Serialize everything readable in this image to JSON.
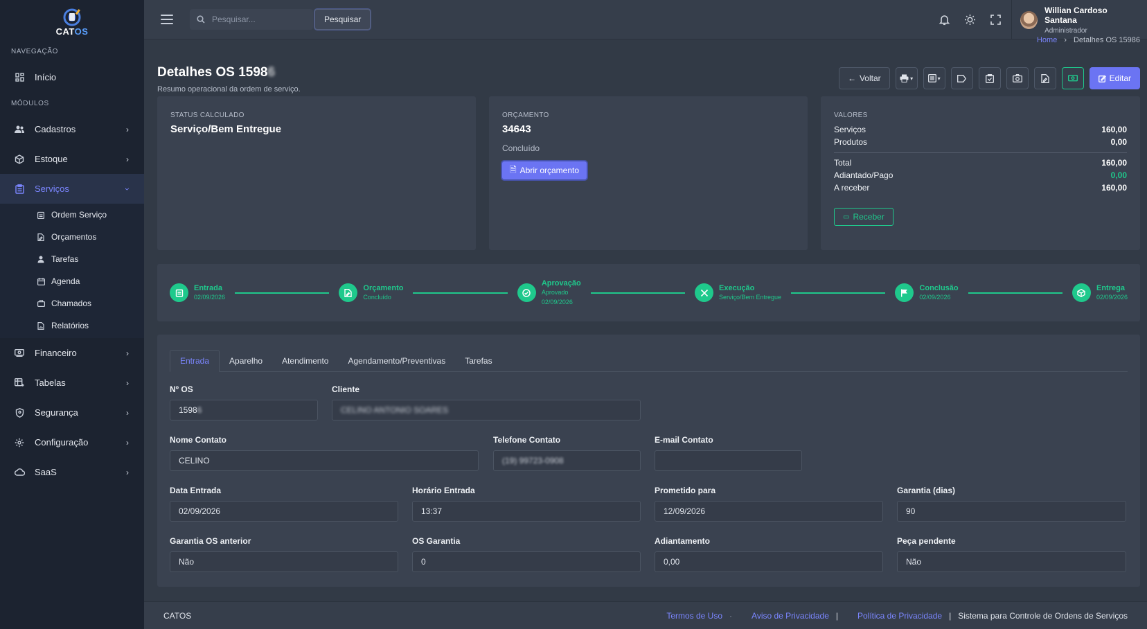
{
  "brand": {
    "logo_text_main": "CAT",
    "logo_text_accent": "OS"
  },
  "sidebar": {
    "section_nav": "NAVEGAÇÃO",
    "section_modules": "MÓDULOS",
    "inicio": "Início",
    "items": [
      {
        "label": "Cadastros",
        "icon": "users-icon"
      },
      {
        "label": "Estoque",
        "icon": "box-icon"
      },
      {
        "label": "Serviços",
        "icon": "clipboard-icon"
      },
      {
        "label": "Financeiro",
        "icon": "money-icon"
      },
      {
        "label": "Tabelas",
        "icon": "table-icon"
      },
      {
        "label": "Segurança",
        "icon": "shield-icon"
      },
      {
        "label": "Configuração",
        "icon": "gear-icon"
      },
      {
        "label": "SaaS",
        "icon": "cloud-icon"
      }
    ],
    "sub_items": [
      "Ordem Serviço",
      "Orçamentos",
      "Tarefas",
      "Agenda",
      "Chamados",
      "Relatórios"
    ]
  },
  "topbar": {
    "search_placeholder": "Pesquisar...",
    "search_button": "Pesquisar",
    "user_name": "Willian Cardoso Santana",
    "user_role": "Administrador"
  },
  "breadcrumb": {
    "home": "Home",
    "sep": "›",
    "current": "Detalhes OS 15986"
  },
  "header": {
    "title": "Detalhes OS 1598",
    "subtitle": "Resumo operacional da ordem de serviço.",
    "back": "Voltar",
    "edit": "Editar"
  },
  "status_card": {
    "label": "STATUS CALCULADO",
    "value": "Serviço/Bem Entregue"
  },
  "budget_card": {
    "label": "ORÇAMENTO",
    "number": "34643",
    "status": "Concluído",
    "open_button": "Abrir orçamento"
  },
  "values_card": {
    "label": "VALORES",
    "servicos_label": "Serviços",
    "servicos": "160,00",
    "produtos_label": "Produtos",
    "produtos": "0,00",
    "total_label": "Total",
    "total": "160,00",
    "adiantado_label": "Adiantado/Pago",
    "adiantado": "0,00",
    "receber_label": "A receber",
    "receber": "160,00",
    "receber_button": "Receber",
    "accent_green": "#1fc98c"
  },
  "timeline": [
    {
      "title": "Entrada",
      "lines": [
        "02/09/2026"
      ]
    },
    {
      "title": "Orçamento",
      "lines": [
        "Concluído"
      ]
    },
    {
      "title": "Aprovação",
      "lines": [
        "Aprovado",
        "02/09/2026"
      ]
    },
    {
      "title": "Execução",
      "lines": [
        "Serviço/Bem Entregue"
      ]
    },
    {
      "title": "Conclusão",
      "lines": [
        "02/09/2026"
      ]
    },
    {
      "title": "Entrega",
      "lines": [
        "02/09/2026"
      ]
    }
  ],
  "tabs": [
    "Entrada",
    "Aparelho",
    "Atendimento",
    "Agendamento/Preventivas",
    "Tarefas"
  ],
  "form": {
    "num_os": {
      "label": "Nº OS",
      "value": "15986"
    },
    "cliente": {
      "label": "Cliente",
      "value": "CELINO ANTONIO SOARES"
    },
    "nome_contato": {
      "label": "Nome Contato",
      "value": "CELINO"
    },
    "telefone": {
      "label": "Telefone Contato",
      "value": "(19) 99723-0908"
    },
    "email": {
      "label": "E-mail Contato",
      "value": ""
    },
    "data_entrada": {
      "label": "Data Entrada",
      "value": "02/09/2026"
    },
    "horario_entrada": {
      "label": "Horário Entrada",
      "value": "13:37"
    },
    "prometido": {
      "label": "Prometido para",
      "value": "12/09/2026"
    },
    "garantia_dias": {
      "label": "Garantia (dias)",
      "value": "90"
    },
    "garantia_os_anterior": {
      "label": "Garantia OS anterior",
      "value": "Não"
    },
    "os_garantia": {
      "label": "OS Garantia",
      "value": "0"
    },
    "adiantamento": {
      "label": "Adiantamento",
      "value": "0,00"
    },
    "peca_pendente": {
      "label": "Peça pendente",
      "value": "Não"
    }
  },
  "footer": {
    "brand": "CATOS",
    "termos": "Termos de Uso",
    "aviso": "Aviso de Privacidade",
    "politica": "Política de Privacidade",
    "desc": "Sistema para Controle de Ordens de Serviços"
  }
}
